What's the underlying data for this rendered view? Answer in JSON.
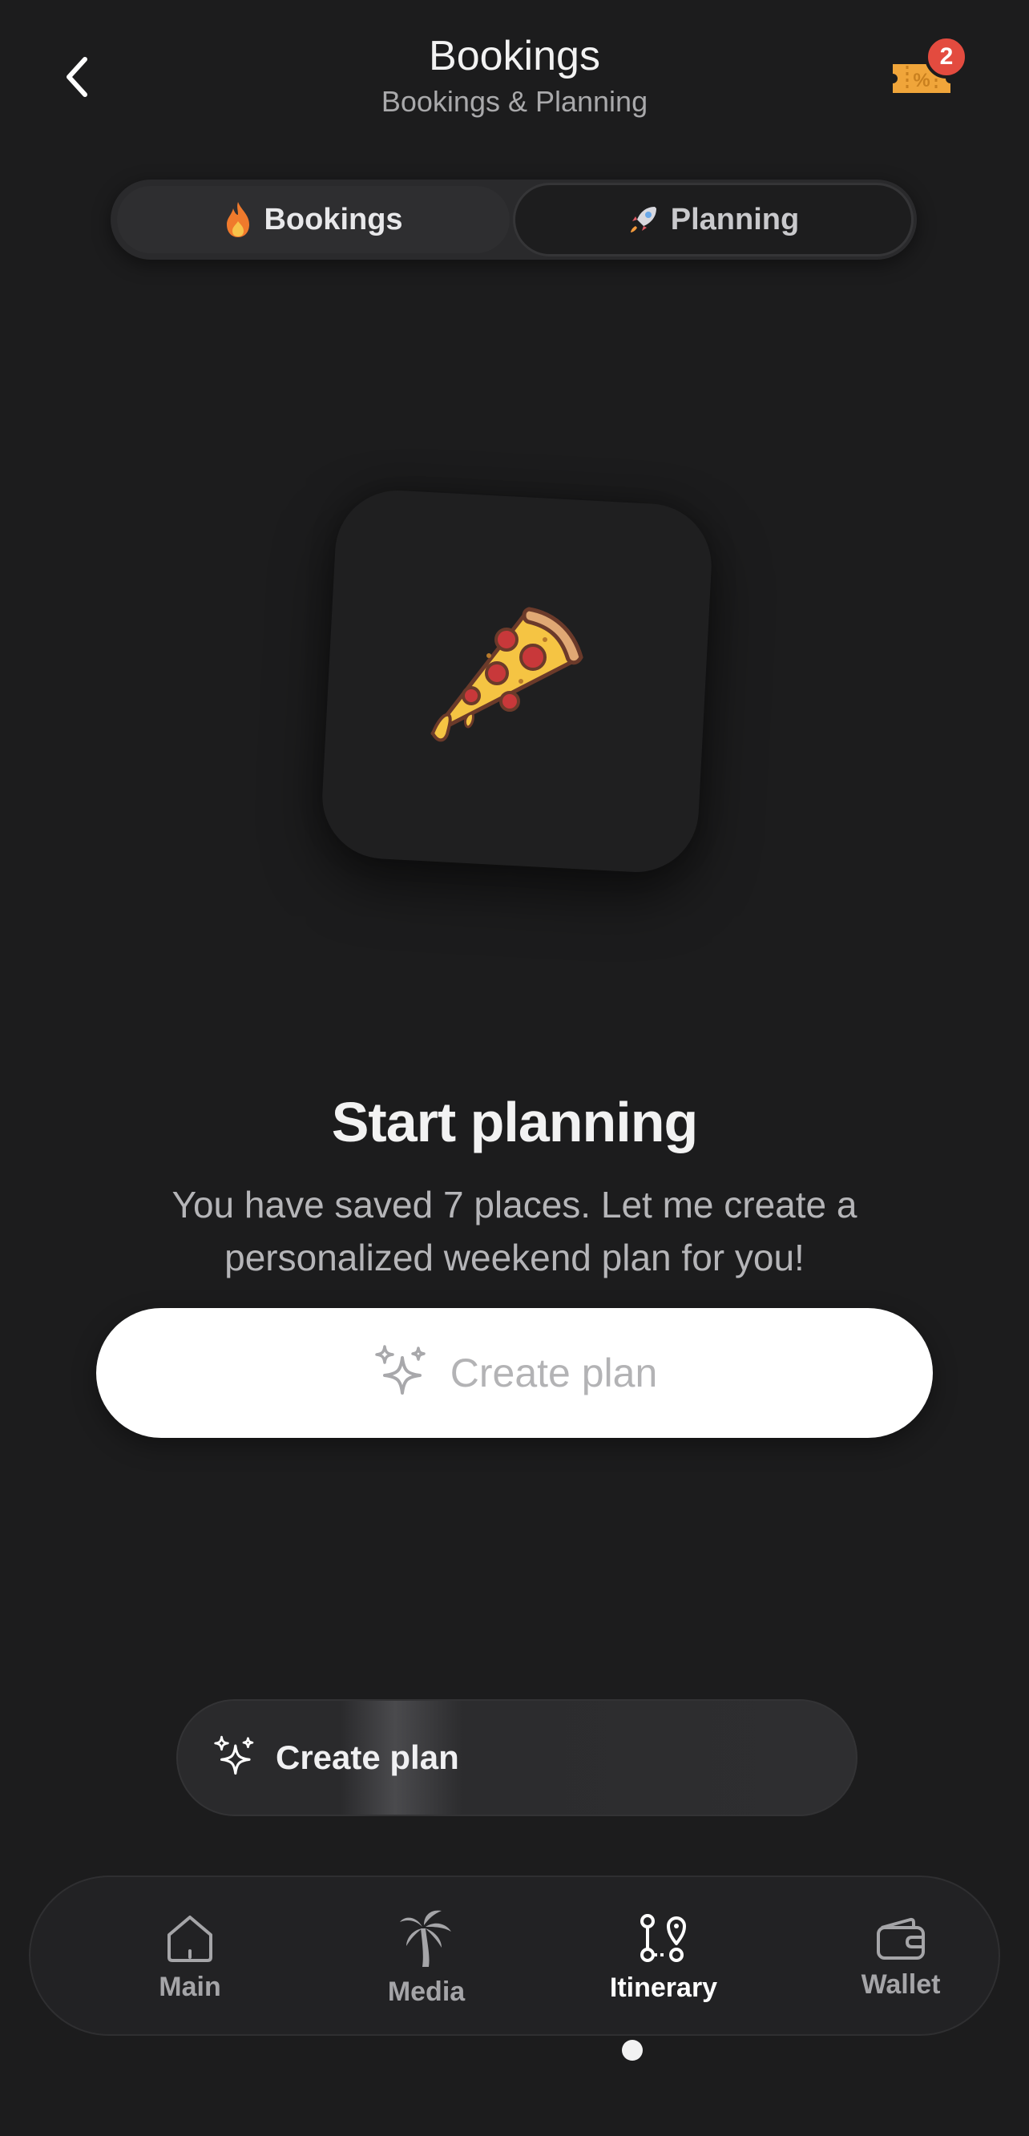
{
  "header": {
    "title": "Bookings",
    "subtitle": "Bookings & Planning",
    "coupon_badge_count": "2"
  },
  "segments": [
    {
      "label": "Bookings",
      "icon": "fire-icon",
      "active": true
    },
    {
      "label": "Planning",
      "icon": "rocket-icon",
      "active": false
    }
  ],
  "illustration": {
    "icon": "pizza-icon"
  },
  "empty_state": {
    "headline": "Start planning",
    "description": "You have saved 7 places. Let me create a personalized weekend plan for you!",
    "cta_label": "Create plan"
  },
  "floating_action": {
    "label": "Create plan",
    "icon": "sparkles-icon"
  },
  "tabbar": {
    "items": [
      {
        "label": "Main",
        "icon": "home-icon",
        "active": false
      },
      {
        "label": "Media",
        "icon": "palm-tree-icon",
        "active": false
      },
      {
        "label": "Itinerary",
        "icon": "route-icon",
        "active": true
      },
      {
        "label": "Wallet",
        "icon": "wallet-icon",
        "active": false
      }
    ]
  },
  "colors": {
    "background": "#1c1c1d",
    "badge": "#e34b3f",
    "coupon": "#f0a53a"
  }
}
